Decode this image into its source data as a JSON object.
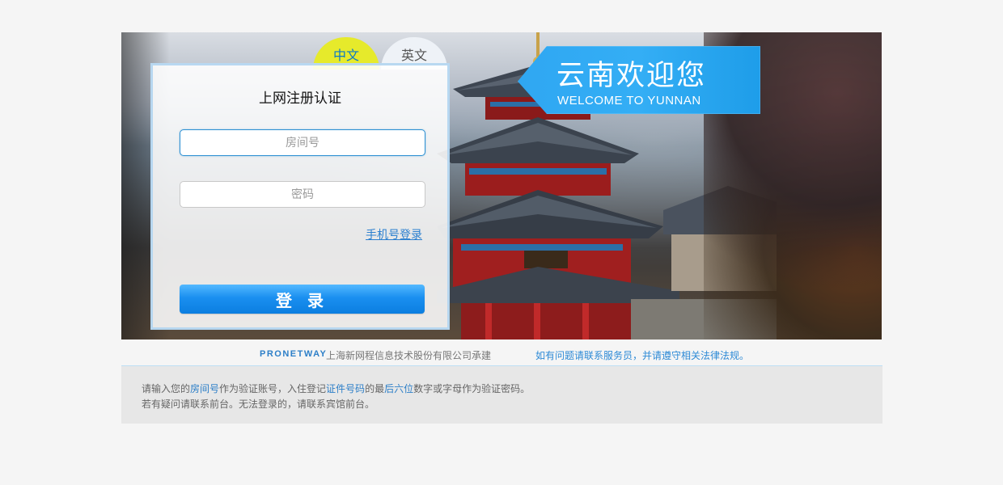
{
  "language_tabs": {
    "chinese": "中文",
    "english": "英文"
  },
  "login": {
    "title": "上网注册认证",
    "room_placeholder": "房间号",
    "password_placeholder": "密码",
    "phone_login_link": "手机号登录",
    "submit_label": "登 录"
  },
  "banner": {
    "welcome_title": "云南欢迎您",
    "welcome_subtitle": "WELCOME TO YUNNAN"
  },
  "footer": {
    "brand": "PRONETWAY",
    "company": "上海新网程信息技术股份有限公司承建",
    "notice": "如有问题请联系服务员，并请遵守相关法律法规。"
  },
  "info": {
    "line1_prefix": "请输入您的",
    "line1_room": "房间号",
    "line1_mid": "作为验证账号，入住登记",
    "line1_idnum": "证件号码",
    "line1_mid2": "的最",
    "line1_last6": "后六位",
    "line1_suffix": "数字或字母作为验证密码。",
    "line2": "若有疑问请联系前台。无法登录的，请联系宾馆前台。"
  },
  "colors": {
    "accent_blue": "#1a8ff0",
    "tab_active": "#e6ea2b",
    "welcome_badge": "#34aef5"
  }
}
